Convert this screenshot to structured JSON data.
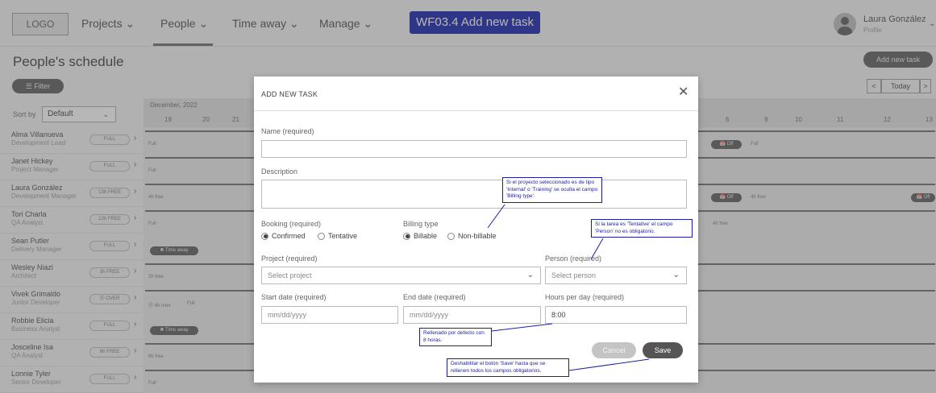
{
  "nav": {
    "logo": "LOGO",
    "items": [
      "Projects ⌄",
      "People ⌄",
      "Time away ⌄",
      "Manage ⌄"
    ],
    "wireframe_label": "WF03.4 Add new task",
    "user_name": "Laura González",
    "user_role": "Profile"
  },
  "page": {
    "title": "People's schedule",
    "add_task": "Add new task",
    "filter": "☰ Filter",
    "today": "Today",
    "prev": "<",
    "next": ">",
    "sort_label": "Sort by",
    "sort_value": "Default"
  },
  "calendar": {
    "month": "December, 2022",
    "days_left": [
      "19",
      "20",
      "21"
    ],
    "days_right": [
      "6",
      "9",
      "10",
      "11",
      "12",
      "13"
    ]
  },
  "people": [
    {
      "name": "Alma Villanueva",
      "role": "Development Lead",
      "badge": "FULL",
      "lane": "Full"
    },
    {
      "name": "Janet Hickey",
      "role": "Project Manager",
      "badge": "FULL",
      "lane": "Full"
    },
    {
      "name": "Laura González",
      "role": "Development Manager",
      "badge": "13h FREE",
      "lane": "4h free"
    },
    {
      "name": "Tori Charla",
      "role": "QA Analyst",
      "badge": "12h FREE",
      "lane": "Full"
    },
    {
      "name": "Sean Putler",
      "role": "Delivery Manager",
      "badge": "FULL",
      "lane": ""
    },
    {
      "name": "Wesley Niazi",
      "role": "Architect",
      "badge": "3h FREE",
      "lane": "2h free"
    },
    {
      "name": "Vivek Grimaldo",
      "role": "Junior Developer",
      "badge": "⓪ OVER",
      "lane": ""
    },
    {
      "name": "Robbie Elicia",
      "role": "Business Analyst",
      "badge": "FULL",
      "lane": ""
    },
    {
      "name": "Josceline Isa",
      "role": "QA Analyst",
      "badge": "8h FREE",
      "lane": "8h free"
    },
    {
      "name": "Lonnie Tyler",
      "role": "Senior Developer",
      "badge": "FULL",
      "lane": "Full"
    }
  ],
  "lane_extras": {
    "off": "📅 Off",
    "time_away": "✖ Time away",
    "over": "⓪ 4h over",
    "full": "Full",
    "four_free": "4h free"
  },
  "modal": {
    "title": "ADD NEW TASK",
    "close": "✕",
    "name_label": "Name (required)",
    "name_value": "",
    "description_label": "Description",
    "description_value": "",
    "booking_label": "Booking (required)",
    "booking_options": [
      "Confirmed",
      "Tentative"
    ],
    "booking_selected": "Confirmed",
    "billing_label": "Billing type",
    "billing_options": [
      "Billable",
      "Non-billable"
    ],
    "billing_selected": "Billable",
    "project_label": "Project (required)",
    "project_placeholder": "Select project",
    "person_label": "Person (required)",
    "person_placeholder": "Select person",
    "start_label": "Start date (required)",
    "start_placeholder": "mm/dd/yyyy",
    "end_label": "End date (required)",
    "end_placeholder": "mm/dd/yyyy",
    "hours_label": "Hours per day (required)",
    "hours_value": "8:00",
    "cancel": "Cancel",
    "save": "Save"
  },
  "notes": {
    "billing": "Si el proyecto seleccionado es de tipo 'Internal' o 'Training' se oculta el campo 'Billing type'.",
    "person": "Si la tarea es 'Tentative' el campo 'Person' no es obligatorio.",
    "hours": "Rellenado por defecto con 8 horas.",
    "save": "Deshabilitar el botón 'Save' hasta que se rellenen todos los campos obligatorios."
  },
  "colors": {
    "wireframe_badge": "#0a14a8",
    "note_border": "#1a1fa0",
    "primary_button": "#555555"
  }
}
